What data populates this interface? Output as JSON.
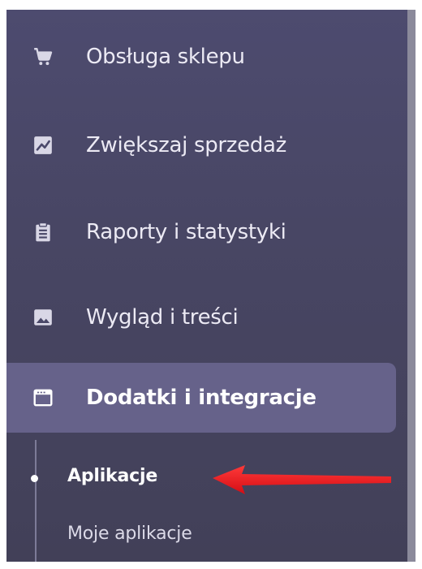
{
  "sidebar": {
    "items": [
      {
        "label": "Obsługa sklepu",
        "icon": "cart-icon",
        "active": false
      },
      {
        "label": "Zwiększaj sprzedaż",
        "icon": "trending-chart-icon",
        "active": false
      },
      {
        "label": "Raporty i statystyki",
        "icon": "clipboard-icon",
        "active": false
      },
      {
        "label": "Wygląd i treści",
        "icon": "image-icon",
        "active": false
      },
      {
        "label": "Dodatki i integracje",
        "icon": "window-icon",
        "active": true
      }
    ],
    "submenu": [
      {
        "label": "Aplikacje",
        "active": true
      },
      {
        "label": "Moje aplikacje",
        "active": false
      }
    ]
  },
  "colors": {
    "sidebar_bg": "#4a4868",
    "active_bg": "#66628a",
    "annotation_arrow": "#e8131b"
  }
}
